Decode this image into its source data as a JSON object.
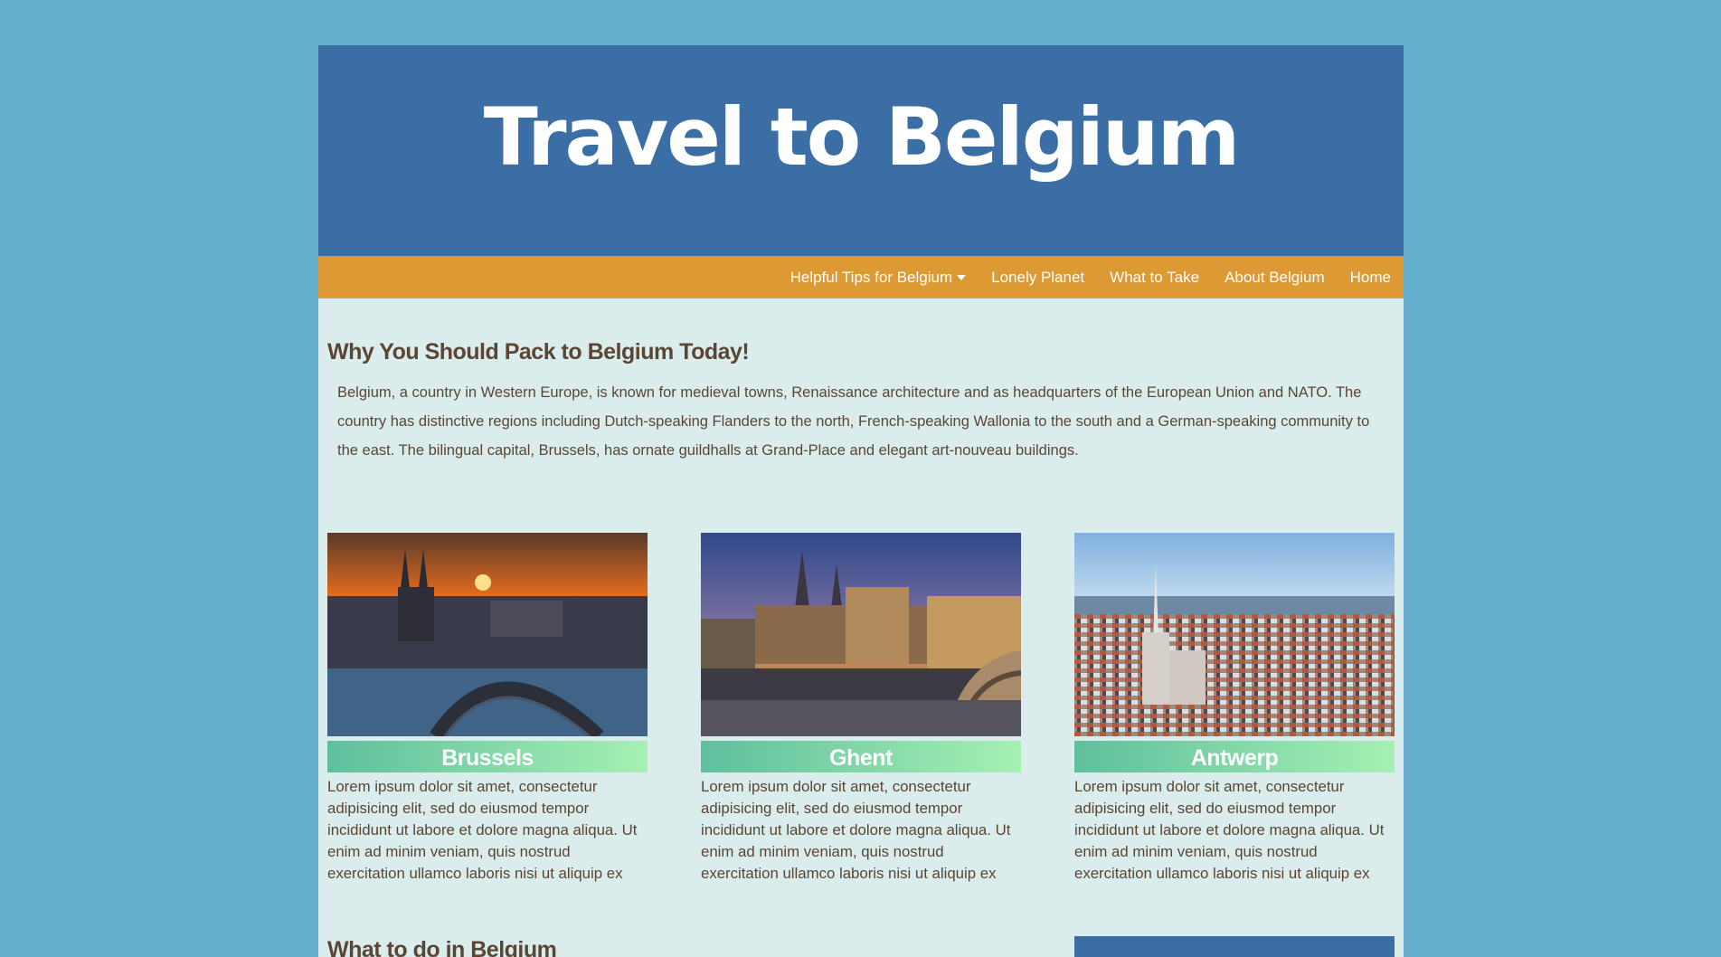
{
  "header": {
    "title": "Travel to Belgium"
  },
  "nav": {
    "items": [
      {
        "label": "Helpful Tips for Belgium",
        "dropdown": true
      },
      {
        "label": "Lonely Planet"
      },
      {
        "label": "What to Take"
      },
      {
        "label": "About Belgium"
      },
      {
        "label": "Home"
      }
    ]
  },
  "intro": {
    "heading": "Why You Should Pack to Belgium Today!",
    "body": "Belgium, a country in Western Europe, is known for medieval towns, Renaissance architecture and as headquarters of the European Union and NATO. The country has distinctive regions including Dutch-speaking Flanders to the north, French-speaking Wallonia to the south and a German-speaking community to the east. The bilingual capital, Brussels, has ornate guildhalls at Grand-Place and elegant art-nouveau buildings."
  },
  "cards": [
    {
      "title": "Brussels",
      "text": "Lorem ipsum dolor sit amet, consectetur adipisicing elit, sed do eiusmod tempor incididunt ut labore et dolore magna aliqua. Ut enim ad minim veniam, quis nostrud exercitation ullamco laboris nisi ut aliquip ex"
    },
    {
      "title": "Ghent",
      "text": "Lorem ipsum dolor sit amet, consectetur adipisicing elit, sed do eiusmod tempor incididunt ut labore et dolore magna aliqua. Ut enim ad minim veniam, quis nostrud exercitation ullamco laboris nisi ut aliquip ex"
    },
    {
      "title": "Antwerp",
      "text": "Lorem ipsum dolor sit amet, consectetur adipisicing elit, sed do eiusmod tempor incididunt ut labore et dolore magna aliqua. Ut enim ad minim veniam, quis nostrud exercitation ullamco laboris nisi ut aliquip ex"
    }
  ],
  "section2": {
    "heading": "What to do in Belgium"
  },
  "colors": {
    "background": "#64afce",
    "header": "#3b6ea5",
    "nav": "#dd9933",
    "content": "#daeceb",
    "text": "#5b4636"
  }
}
